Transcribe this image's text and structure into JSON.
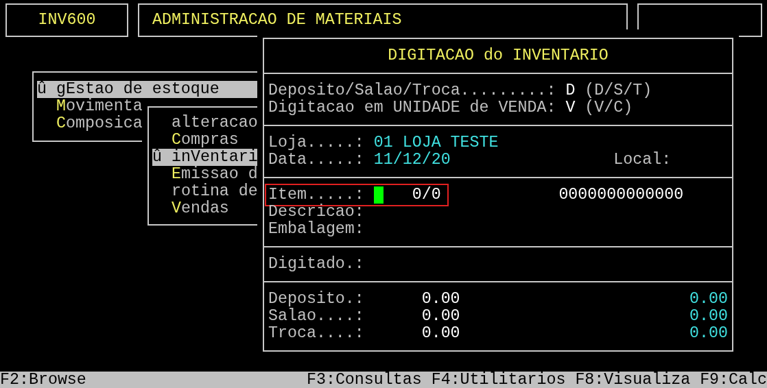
{
  "header": {
    "program": "INV600",
    "title": "ADMINISTRACAO DE MATERIAIS"
  },
  "menu": {
    "items": [
      {
        "marker": "û",
        "label": "gEstao de estoque",
        "selected": true
      },
      {
        "hotkey": "M",
        "label": "ovimenta",
        "selected": false
      },
      {
        "hotkey": "C",
        "label": "omposica",
        "selected": false
      }
    ]
  },
  "submenu": {
    "items": [
      {
        "label": "alteracao",
        "selected": false
      },
      {
        "hotkey": "C",
        "label": "ompras",
        "selected": false
      },
      {
        "marker": "û",
        "label": "inVentari",
        "selected": true
      },
      {
        "hotkey": "E",
        "label": "missao d",
        "selected": false
      },
      {
        "label": "rotina de",
        "selected": false
      },
      {
        "hotkey": "V",
        "label": "endas",
        "selected": false
      }
    ]
  },
  "panel": {
    "title": "DIGITACAO do INVENTARIO",
    "options": [
      {
        "label": "Deposito/Salao/Troca.........:",
        "value": "D",
        "hint": "(D/S/T)"
      },
      {
        "label": "Digitacao em UNIDADE de VENDA:",
        "value": "V",
        "hint": "(V/C)"
      }
    ],
    "store": {
      "label": "Loja.....:",
      "value": "01 LOJA TESTE"
    },
    "date": {
      "label": "Data.....:",
      "value": "11/12/20",
      "local_label": "Local:"
    },
    "item": {
      "label": "Item.....:",
      "cursor": true,
      "count": "0/0",
      "code": "0000000000000",
      "highlighted": true
    },
    "description_label": "Descricao:",
    "packaging_label": "Embalagem:",
    "typed_label": "Digitado.:",
    "totals": [
      {
        "label": "Deposito.:",
        "value": "0.00",
        "total": "0.00"
      },
      {
        "label": "Salao....:",
        "value": "0.00",
        "total": "0.00"
      },
      {
        "label": "Troca....:",
        "value": "0.00",
        "total": "0.00"
      }
    ]
  },
  "status_bar": {
    "left": "F2:Browse",
    "right": "F3:Consultas F4:Utilitarios F8:Visualiza F9:Calc"
  }
}
